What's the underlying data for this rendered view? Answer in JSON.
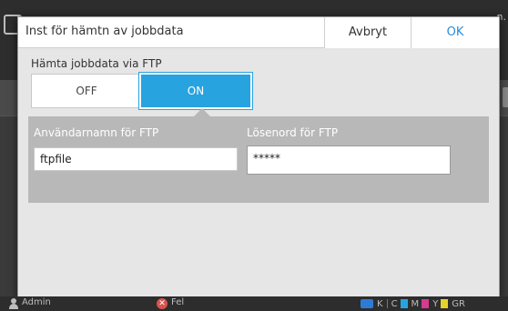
{
  "background": {
    "top_right_text": "n."
  },
  "dialog": {
    "title": "Inst för hämtn av jobbdata",
    "cancel_label": "Avbryt",
    "ok_label": "OK",
    "ftp_label": "Hämta jobbdata via FTP",
    "toggle": {
      "off_label": "OFF",
      "on_label": "ON",
      "selected": "ON"
    },
    "username_label": "Användarnamn för FTP",
    "username_value": "ftpfile",
    "password_label": "Lösenord för FTP",
    "password_value": "*****"
  },
  "footer": {
    "user": "Admin",
    "error_label": "Fel",
    "inks": [
      {
        "label": "K",
        "color": "#333333"
      },
      {
        "label": "C",
        "color": "#27a3e0"
      },
      {
        "label": "M",
        "color": "#d63b8f"
      },
      {
        "label": "Y",
        "color": "#e6d22b"
      },
      {
        "label": "GR",
        "color": "#9a9a9a"
      }
    ]
  },
  "colors": {
    "accent": "#27a3e0",
    "ok_text": "#2a8cd8"
  }
}
